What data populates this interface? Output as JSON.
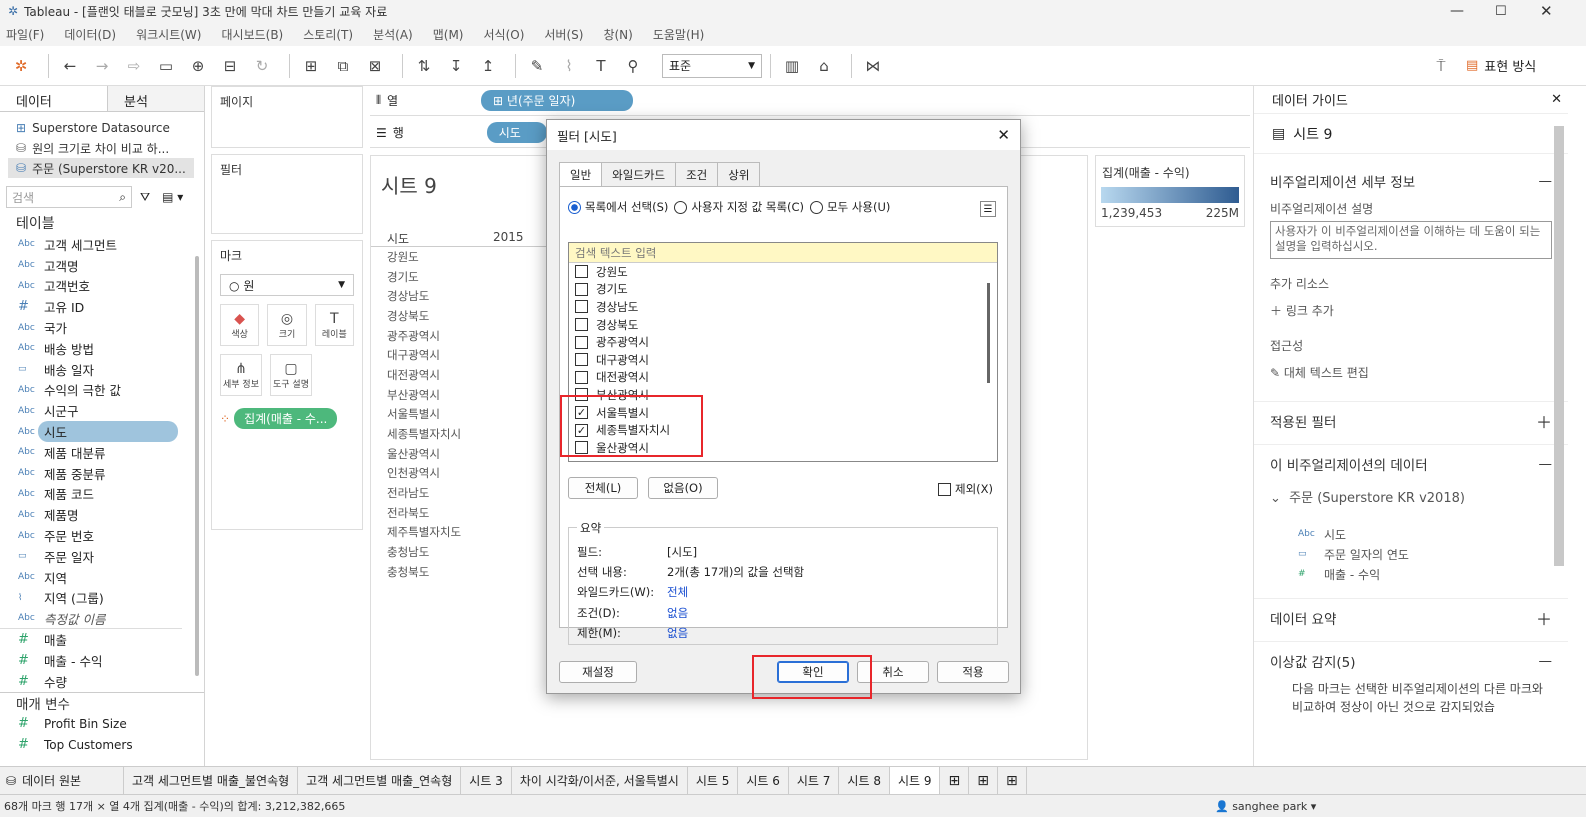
{
  "window": {
    "title": "Tableau - [플랜잇 태블로 굿모닝] 3초 만에 막대 차트 만들기 교육 자료"
  },
  "menu": [
    "파일(F)",
    "데이터(D)",
    "워크시트(W)",
    "대시보드(B)",
    "스토리(T)",
    "분석(A)",
    "맵(M)",
    "서식(O)",
    "서버(S)",
    "창(N)",
    "도움말(H)"
  ],
  "toolbar": {
    "fit": "표준",
    "show_me": "표현 방식"
  },
  "left": {
    "tabs": [
      "데이터",
      "분석"
    ],
    "datasources": [
      "Superstore Datasource",
      "원의 크기로 차이 비교 하...",
      "주문 (Superstore KR v20..."
    ],
    "search_placeholder": "검색",
    "tables_label": "테이블",
    "fields": [
      {
        "type": "Abc",
        "name": "고객 세그먼트"
      },
      {
        "type": "Abc",
        "name": "고객명"
      },
      {
        "type": "Abc",
        "name": "고객번호"
      },
      {
        "type": "#",
        "name": "고유 ID"
      },
      {
        "type": "Abc",
        "name": "국가"
      },
      {
        "type": "Abc",
        "name": "배송 방법"
      },
      {
        "type": "cal",
        "name": "배송 일자"
      },
      {
        "type": "Abc",
        "name": "수익의 극한 값"
      },
      {
        "type": "Abc",
        "name": "시군구"
      },
      {
        "type": "Abc",
        "name": "시도"
      },
      {
        "type": "Abc",
        "name": "제품 대분류"
      },
      {
        "type": "Abc",
        "name": "제품 중분류"
      },
      {
        "type": "Abc",
        "name": "제품 코드"
      },
      {
        "type": "Abc",
        "name": "제품명"
      },
      {
        "type": "Abc",
        "name": "주문 번호"
      },
      {
        "type": "cal",
        "name": "주문 일자"
      },
      {
        "type": "Abc",
        "name": "지역"
      },
      {
        "type": "clip",
        "name": "지역 (그룹)"
      },
      {
        "type": "Abc",
        "name": "측정값 이름"
      },
      {
        "type": "#",
        "name": "매출"
      },
      {
        "type": "#",
        "name": "매출 - 수익"
      },
      {
        "type": "#",
        "name": "수량"
      }
    ],
    "params_label": "매개 변수",
    "params": [
      "Profit Bin Size",
      "Top Customers"
    ]
  },
  "shelves": {
    "pages": "페이지",
    "filters": "필터",
    "marks": "마크",
    "mark_type": "원",
    "mark_buttons": [
      "색상",
      "크기",
      "레이블",
      "세부 정보",
      "도구 설명"
    ],
    "color_pill": "집계(매출 - 수...",
    "columns_label": "열",
    "columns_pill": "⊞ 년(주문 일자)",
    "rows_label": "행",
    "rows_pill": "시도"
  },
  "view": {
    "title": "시트 9",
    "row_header": "시도",
    "col_header": "2015",
    "rows": [
      "강원도",
      "경기도",
      "경상남도",
      "경상북도",
      "광주광역시",
      "대구광역시",
      "대전광역시",
      "부산광역시",
      "서울특별시",
      "세종특별자치시",
      "울산광역시",
      "인천광역시",
      "전라남도",
      "전라북도",
      "제주특별자치도",
      "충청남도",
      "충청북도"
    ],
    "dark_rows": [
      1,
      8
    ]
  },
  "legend": {
    "title": "집계(매출 - 수익)",
    "min": "1,239,453",
    "max": "225M"
  },
  "dialog": {
    "title": "필터 [시도]",
    "tabs": [
      "일반",
      "와일드카드",
      "조건",
      "상위"
    ],
    "radios": [
      "목록에서 선택(S)",
      "사용자 지정 값 목록(C)",
      "모두 사용(U)"
    ],
    "search_placeholder": "검색 텍스트 입력",
    "items": [
      {
        "label": "강원도",
        "checked": false
      },
      {
        "label": "경기도",
        "checked": false
      },
      {
        "label": "경상남도",
        "checked": false
      },
      {
        "label": "경상북도",
        "checked": false
      },
      {
        "label": "광주광역시",
        "checked": false
      },
      {
        "label": "대구광역시",
        "checked": false
      },
      {
        "label": "대전광역시",
        "checked": false
      },
      {
        "label": "부산광역시",
        "checked": false
      },
      {
        "label": "서울특별시",
        "checked": true
      },
      {
        "label": "세종특별자치시",
        "checked": true
      },
      {
        "label": "울산광역시",
        "checked": false
      }
    ],
    "all_btn": "전체(L)",
    "none_btn": "없음(O)",
    "exclude": "제외(X)",
    "summary_label": "요약",
    "summary": [
      {
        "k": "필드:",
        "v": "[시도]",
        "blue": false
      },
      {
        "k": "선택 내용:",
        "v": "2개(총 17개)의 값을 선택함",
        "blue": false
      },
      {
        "k": "와일드카드(W):",
        "v": "전체",
        "blue": true
      },
      {
        "k": "조건(D):",
        "v": "없음",
        "blue": true
      },
      {
        "k": "제한(M):",
        "v": "없음",
        "blue": true
      }
    ],
    "reset": "재설정",
    "ok": "확인",
    "cancel": "취소",
    "apply": "적용"
  },
  "right": {
    "header": "데이터 가이드",
    "sheet": "시트 9",
    "viz_details": "비주얼리제이션 세부 정보",
    "viz_desc_label": "비주얼리제이션 설명",
    "viz_desc_placeholder": "사용자가 이 비주얼리제이션을 이해하는 데 도움이 되는 설명을 입력하십시오.",
    "resources": "추가 리소스",
    "add_link": "링크 추가",
    "access": "접근성",
    "alt_text": "대체 텍스트 편집",
    "applied_filters": "적용된 필터",
    "viz_data": "이 비주얼리제이션의 데이터",
    "ds_name": "주문 (Superstore KR v2018)",
    "data_fields": [
      {
        "type": "Abc",
        "name": "시도"
      },
      {
        "type": "cal",
        "name": "주문 일자의 연도"
      },
      {
        "type": "#",
        "name": "매출 - 수익"
      }
    ],
    "data_summary": "데이터 요약",
    "outliers": "이상값 감지(5)",
    "outlier_text": "다음 마크는 선택한 비주얼리제이션의 다른 마크와 비교하여 정상이 아닌 것으로 감지되었습"
  },
  "statusbar": {
    "datasource": "데이터 원본",
    "tabs": [
      "고객 세그먼트별 매출_불연속형",
      "고객 세그먼트별 매출_연속형",
      "시트 3",
      "차이 시각화/이서준, 서울특별시",
      "시트 5",
      "시트 6",
      "시트 7",
      "시트 8",
      "시트 9"
    ],
    "active": 8,
    "footer": "68개 마크    행 17개 × 열 4개    집계(매출 - 수익)의 합계: 3,212,382,665",
    "user": "sanghee park"
  }
}
